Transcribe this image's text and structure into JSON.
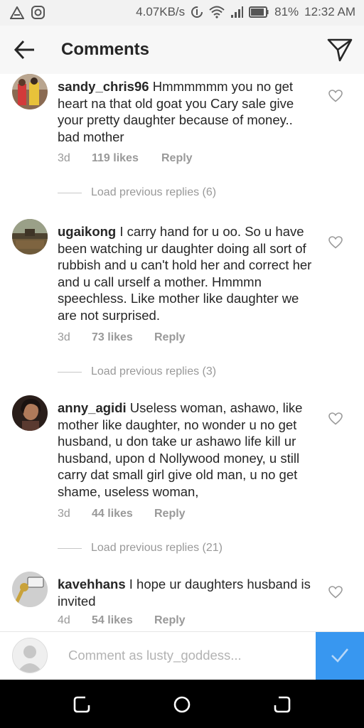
{
  "status_bar": {
    "speed": "4.07KB/s",
    "battery": "81%",
    "time": "12:32 AM",
    "icons": [
      "warning-triangle-icon",
      "instagram-icon",
      "data-saver-icon",
      "wifi-icon",
      "signal-icon",
      "battery-icon"
    ]
  },
  "header": {
    "title": "Comments",
    "back_icon": "back-arrow-icon",
    "send_icon": "direct-send-icon"
  },
  "comments": [
    {
      "username": "sandy_chris96",
      "text": "Hmmmmmm you no get heart na that old goat you Cary sale give your pretty daughter because of money.. bad mother",
      "time": "3d",
      "likes": "119 likes",
      "reply": "Reply",
      "load_replies": "Load previous replies (6)"
    },
    {
      "username": "ugaikong",
      "text": "I carry hand for u oo. So u have been watching ur daughter doing all sort of rubbish and u can't hold her and correct her and u call urself a mother. Hmmmn speechless. Like mother like daughter we are not surprised.",
      "time": "3d",
      "likes": "73 likes",
      "reply": "Reply",
      "load_replies": "Load previous replies (3)"
    },
    {
      "username": "anny_agidi",
      "text": "Useless woman, ashawo, like mother like daughter, no wonder u no get husband, u don take ur ashawo life kill ur husband, upon d Nollywood money, u still carry dat small girl give old man, u no get shame, useless woman,",
      "time": "3d",
      "likes": "44 likes",
      "reply": "Reply",
      "load_replies": "Load previous replies (21)"
    },
    {
      "username": "kavehhans",
      "text": "I hope ur daughters husband is invited",
      "time": "4d",
      "likes": "54 likes",
      "reply": "Reply"
    }
  ],
  "composer": {
    "placeholder": "Comment as lusty_goddess...",
    "value": ""
  },
  "colors": {
    "accent": "#3897f0",
    "text": "#262626",
    "muted": "#999999"
  }
}
